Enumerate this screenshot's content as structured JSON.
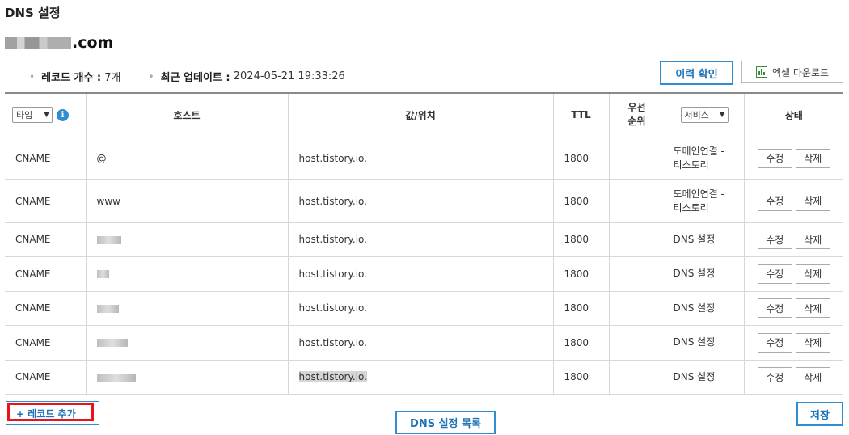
{
  "page": {
    "title": "DNS 설정"
  },
  "domain": {
    "suffix": ".com"
  },
  "summary": {
    "record_count_label": "레코드 개수 :",
    "record_count_value": "7개",
    "last_update_label": "최근 업데이트 :",
    "last_update_value": "2024-05-21 19:33:26"
  },
  "toolbar": {
    "history_label": "이력 확인",
    "excel_label": "엑셀 다운로드"
  },
  "table": {
    "headers": {
      "type_select": "타입",
      "host": "호스트",
      "value": "값/위치",
      "ttl": "TTL",
      "priority_line1": "우선",
      "priority_line2": "순위",
      "service_select": "서비스",
      "status": "상태"
    },
    "edit_label": "수정",
    "delete_label": "삭제",
    "rows": [
      {
        "type": "CNAME",
        "host": "@",
        "value": "host.tistory.io.",
        "ttl": "1800",
        "priority": "",
        "service_line1": "도메인연결 -",
        "service_line2": "티스토리"
      },
      {
        "type": "CNAME",
        "host": "www",
        "value": "host.tistory.io.",
        "ttl": "1800",
        "priority": "",
        "service_line1": "도메인연결 -",
        "service_line2": "티스토리"
      },
      {
        "type": "CNAME",
        "host": "",
        "value": "host.tistory.io.",
        "ttl": "1800",
        "priority": "",
        "service_line1": "DNS 설정",
        "service_line2": ""
      },
      {
        "type": "CNAME",
        "host": "",
        "value": "host.tistory.io.",
        "ttl": "1800",
        "priority": "",
        "service_line1": "DNS 설정",
        "service_line2": ""
      },
      {
        "type": "CNAME",
        "host": "",
        "value": "host.tistory.io.",
        "ttl": "1800",
        "priority": "",
        "service_line1": "DNS 설정",
        "service_line2": ""
      },
      {
        "type": "CNAME",
        "host": "",
        "value": "host.tistory.io.",
        "ttl": "1800",
        "priority": "",
        "service_line1": "DNS 설정",
        "service_line2": ""
      },
      {
        "type": "CNAME",
        "host": "",
        "value": "host.tistory.io.",
        "ttl": "1800",
        "priority": "",
        "service_line1": "DNS 설정",
        "service_line2": ""
      }
    ]
  },
  "footer": {
    "add_record_label": "+ 레코드 추가",
    "dns_list_label": "DNS 설정 목록",
    "save_label": "저장"
  },
  "colors": {
    "accent_blue": "#2f8dd1",
    "highlight_red": "#e8141c",
    "info_icon": "#2f8dd1",
    "excel_green": "#3b8a3b"
  },
  "icons": {
    "info": "info-icon",
    "excel": "excel-chart-icon",
    "dropdown": "chevron-down-icon"
  }
}
